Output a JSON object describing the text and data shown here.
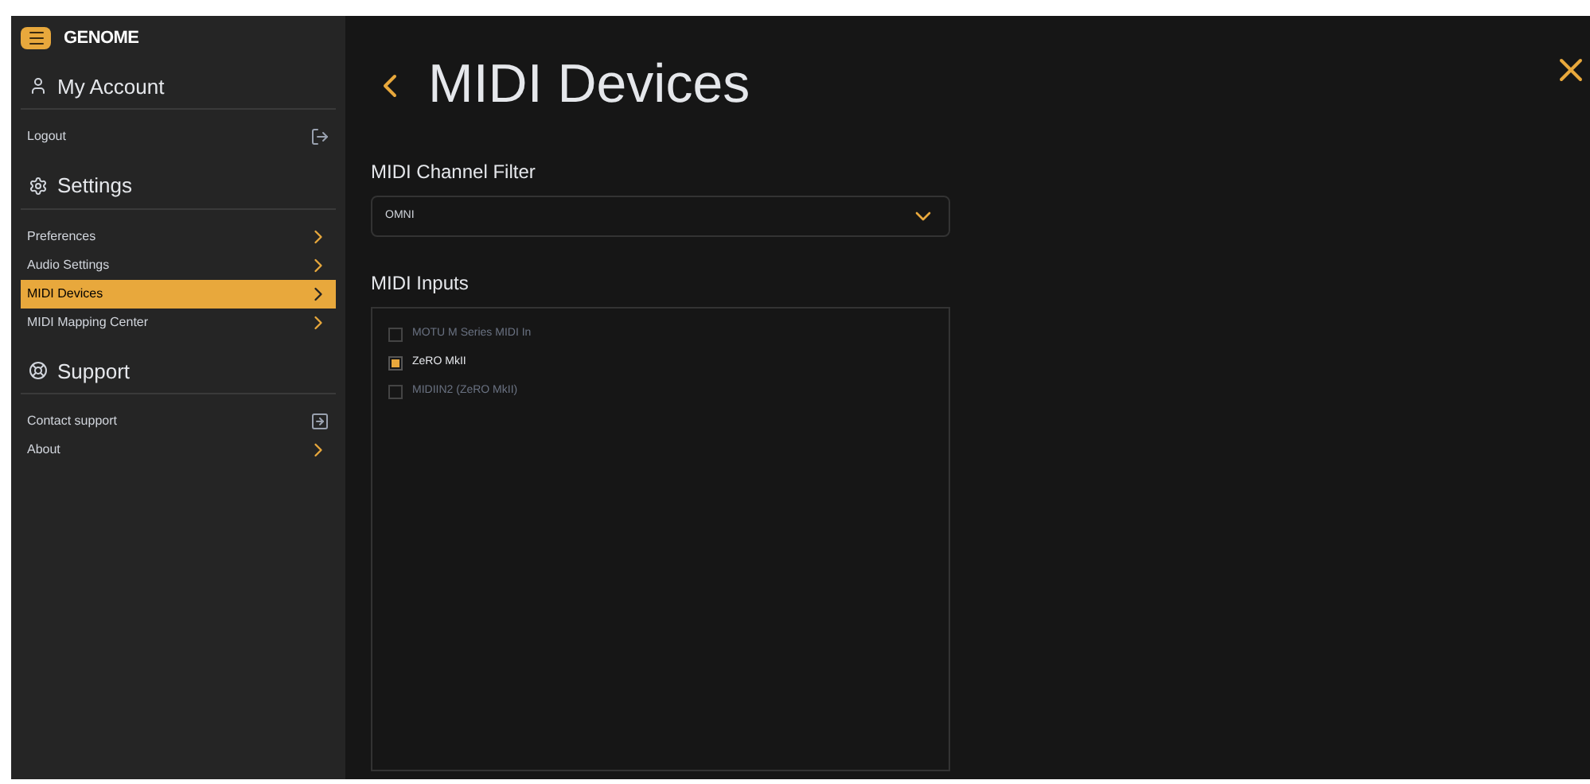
{
  "sidebar": {
    "logo": "GENOME",
    "sections": [
      {
        "kind": "account",
        "title": "My Account",
        "items": [
          {
            "label": "Logout",
            "kind": "logout",
            "selected": false
          }
        ]
      },
      {
        "kind": "settings",
        "title": "Settings",
        "items": [
          {
            "label": "Preferences",
            "kind": "chevron",
            "selected": false
          },
          {
            "label": "Audio Settings",
            "kind": "chevron",
            "selected": false
          },
          {
            "label": "MIDI Devices",
            "kind": "chevron",
            "selected": true
          },
          {
            "label": "MIDI Mapping Center",
            "kind": "chevron",
            "selected": false
          }
        ]
      },
      {
        "kind": "support",
        "title": "Support",
        "items": [
          {
            "label": "Contact support",
            "kind": "external",
            "selected": false
          },
          {
            "label": "About",
            "kind": "chevron",
            "selected": false
          }
        ]
      }
    ]
  },
  "page": {
    "title": "MIDI Devices",
    "channel_filter": {
      "label": "MIDI Channel Filter",
      "value": "OMNI"
    },
    "inputs": {
      "label": "MIDI Inputs",
      "items": [
        {
          "label": "MOTU M Series MIDI In",
          "checked": false
        },
        {
          "label": "ZeRO MkII",
          "checked": true
        },
        {
          "label": "MIDIIN2 (ZeRO MkII)",
          "checked": false
        }
      ]
    }
  }
}
